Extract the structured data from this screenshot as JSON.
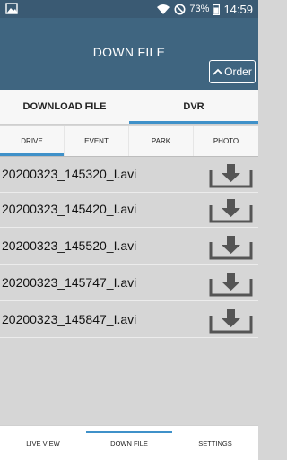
{
  "status_bar": {
    "battery_percent": "73%",
    "time": "14:59",
    "icons": [
      "image-icon",
      "wifi-icon",
      "do-not-disturb-icon",
      "battery-icon"
    ]
  },
  "header": {
    "title": "DOWN FILE",
    "order_label": "Order"
  },
  "main_tabs": [
    {
      "label": "DOWNLOAD FILE",
      "active": false
    },
    {
      "label": "DVR",
      "active": true
    }
  ],
  "sub_tabs": [
    {
      "label": "DRIVE",
      "active": true
    },
    {
      "label": "EVENT",
      "active": false
    },
    {
      "label": "PARK",
      "active": false
    },
    {
      "label": "PHOTO",
      "active": false
    }
  ],
  "files": [
    {
      "name": "20200323_145320_I.avi",
      "icon": "download-icon"
    },
    {
      "name": "20200323_145420_I.avi",
      "icon": "download-icon"
    },
    {
      "name": "20200323_145520_I.avi",
      "icon": "download-icon"
    },
    {
      "name": "20200323_145747_I.avi",
      "icon": "download-icon"
    },
    {
      "name": "20200323_145847_I.avi",
      "icon": "download-icon"
    }
  ],
  "bottom_nav": [
    {
      "label": "LIVE VIEW",
      "active": false
    },
    {
      "label": "DOWN FILE",
      "active": true
    },
    {
      "label": "SETTINGS",
      "active": false
    }
  ],
  "colors": {
    "header_bg": "#3f6580",
    "status_bg": "#3a5a73",
    "accent": "#3f91c9",
    "list_bg": "#d6d6d6"
  }
}
